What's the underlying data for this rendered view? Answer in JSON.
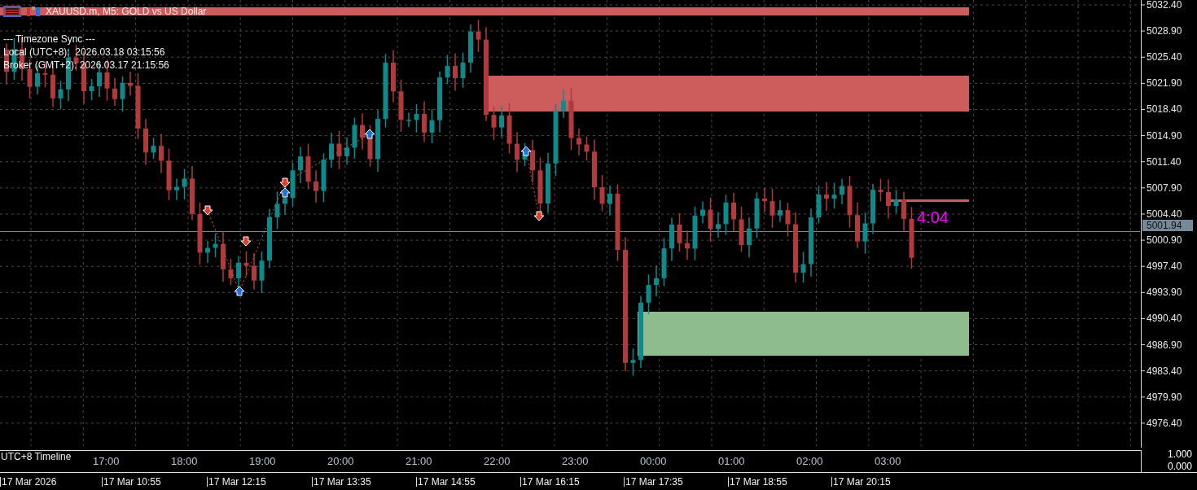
{
  "window": {
    "title": "XAUUSD.m, M5:  GOLD vs US Dollar"
  },
  "info_panel": {
    "lines": [
      "--- Timezone Sync ---",
      "Local (UTC+8):  2026.03.18 03:15:56",
      "Broker (GMT+2): 2026.03.17 21:15:56"
    ]
  },
  "zones": [
    {
      "color": "#cd5c5c"
    },
    {
      "color": "#8fbc8f"
    }
  ],
  "price_axis": {
    "ticks": [
      "5032.40",
      "5028.90",
      "5025.40",
      "5021.90",
      "5018.40",
      "5014.90",
      "5011.40",
      "5007.90",
      "5004.40",
      "5000.90",
      "4997.40",
      "4993.90",
      "4990.40",
      "4986.90",
      "4983.40",
      "4979.90",
      "4976.40"
    ],
    "current_price": "5001.94"
  },
  "countdown": "4:04",
  "subwindow": {
    "label": "UTC+8 Timeline",
    "hours": [
      "17:00",
      "18:00",
      "19:00",
      "20:00",
      "21:00",
      "22:00",
      "23:00",
      "00:00",
      "01:00",
      "02:00",
      "03:00"
    ],
    "scale": [
      "1.000",
      "0.000"
    ]
  },
  "time_axis": {
    "labels": [
      "17 Mar 2026",
      "17 Mar 10:55",
      "17 Mar 12:15",
      "17 Mar 13:35",
      "17 Mar 14:55",
      "17 Mar 16:15",
      "17 Mar 17:35",
      "17 Mar 18:55",
      "17 Mar 20:15"
    ]
  }
}
